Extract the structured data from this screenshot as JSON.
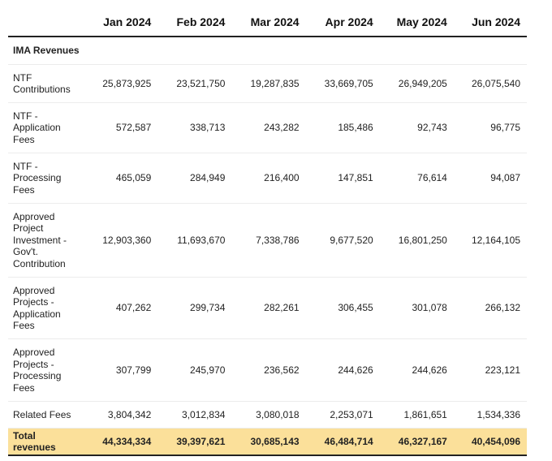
{
  "columns": [
    "",
    "Jan 2024",
    "Feb 2024",
    "Mar 2024",
    "Apr 2024",
    "May 2024",
    "Jun 2024"
  ],
  "section_title": "IMA Revenues",
  "rows": [
    {
      "label": "NTF Contributions",
      "values": [
        "25,873,925",
        "23,521,750",
        "19,287,835",
        "33,669,705",
        "26,949,205",
        "26,075,540"
      ]
    },
    {
      "label": "NTF - Application Fees",
      "values": [
        "572,587",
        "338,713",
        "243,282",
        "185,486",
        "92,743",
        "96,775"
      ]
    },
    {
      "label": "NTF - Processing Fees",
      "values": [
        "465,059",
        "284,949",
        "216,400",
        "147,851",
        "76,614",
        "94,087"
      ]
    },
    {
      "label": "Approved Project Investment - Gov't. Contribution",
      "values": [
        "12,903,360",
        "11,693,670",
        "7,338,786",
        "9,677,520",
        "16,801,250",
        "12,164,105"
      ]
    },
    {
      "label": "Approved Projects - Application Fees",
      "values": [
        "407,262",
        "299,734",
        "282,261",
        "306,455",
        "301,078",
        "266,132"
      ]
    },
    {
      "label": "Approved Projects - Processing Fees",
      "values": [
        "307,799",
        "245,970",
        "236,562",
        "244,626",
        "244,626",
        "223,121"
      ]
    },
    {
      "label": "Related Fees",
      "values": [
        "3,804,342",
        "3,012,834",
        "3,080,018",
        "2,253,071",
        "1,861,651",
        "1,534,336"
      ]
    }
  ],
  "total": {
    "label": "Total revenues",
    "values": [
      "44,334,334",
      "39,397,621",
      "30,685,143",
      "46,484,714",
      "46,327,167",
      "40,454,096"
    ]
  },
  "colors": {
    "total_highlight": "#fbe09a",
    "rule": "#222222",
    "row_divider": "#ececec"
  }
}
